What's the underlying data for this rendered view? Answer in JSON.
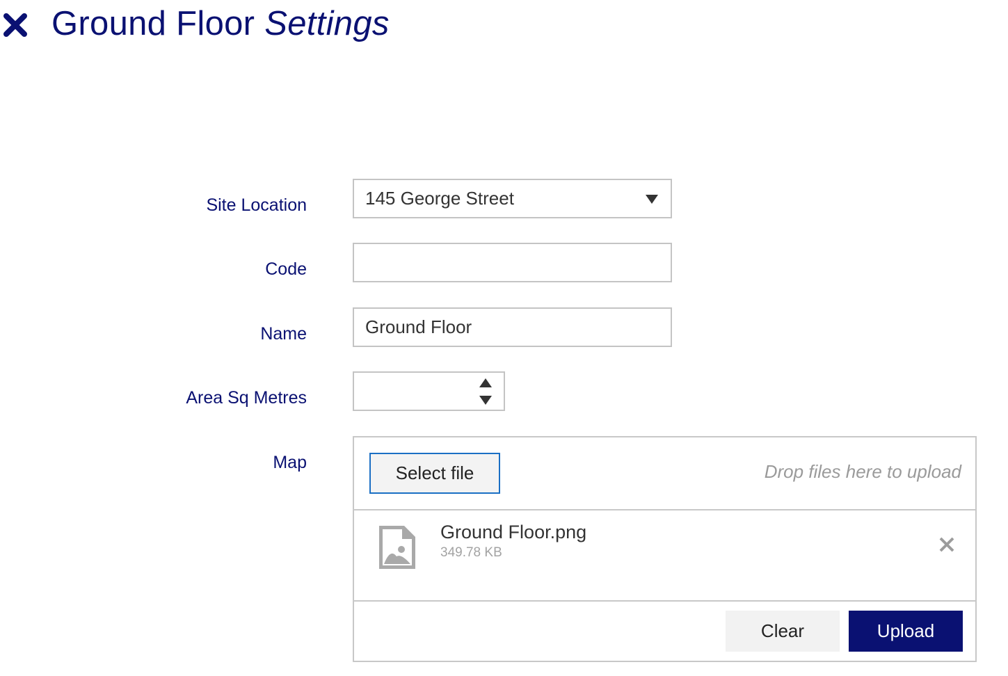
{
  "header": {
    "title_main": "Ground Floor",
    "title_emphasis": "Settings",
    "close_icon": "close-icon"
  },
  "form": {
    "site_location": {
      "label": "Site Location",
      "value": "145 George Street"
    },
    "code": {
      "label": "Code",
      "value": ""
    },
    "name": {
      "label": "Name",
      "value": "Ground Floor"
    },
    "area": {
      "label": "Area Sq Metres",
      "value": ""
    },
    "map": {
      "label": "Map"
    }
  },
  "upload": {
    "select_label": "Select file",
    "drop_hint": "Drop files here to upload",
    "files": [
      {
        "name": "Ground Floor.png",
        "size": "349.78 KB",
        "icon": "image-file-icon"
      }
    ],
    "clear_label": "Clear",
    "upload_label": "Upload"
  },
  "colors": {
    "brand": "#0a1172",
    "focus_border": "#1a6fc4",
    "border": "#c4c4c4"
  }
}
